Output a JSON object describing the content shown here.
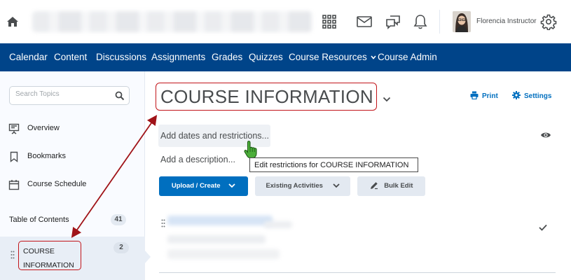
{
  "topbar": {
    "user_name": "Florencia Instructor"
  },
  "nav": {
    "items": [
      "Calendar",
      "Content",
      "Discussions",
      "Assignments",
      "Grades",
      "Quizzes",
      "Course Resources",
      "Course Admin"
    ]
  },
  "sidebar": {
    "search_placeholder": "Search Topics",
    "links": [
      "Overview",
      "Bookmarks",
      "Course Schedule"
    ],
    "toc_label": "Table of Contents",
    "toc_count": "41",
    "module_label": "COURSE INFORMATION",
    "module_count": "2"
  },
  "main": {
    "title": "COURSE INFORMATION",
    "print_label": "Print",
    "settings_label": "Settings",
    "add_dates_label": "Add dates and restrictions...",
    "add_description_label": "Add a description...",
    "tooltip": "Edit restrictions for COURSE INFORMATION",
    "upload_create_label": "Upload / Create",
    "existing_activities_label": "Existing Activities",
    "bulk_edit_label": "Bulk Edit"
  },
  "colors": {
    "nav_background": "#004489",
    "primary_button": "#006fbf",
    "annotation_red": "#c2151a",
    "cursor_green": "#4cae3a"
  },
  "icons": [
    "home-icon",
    "waffle-icon",
    "mail-icon",
    "chat-icon",
    "bell-icon",
    "gear-icon",
    "search-icon",
    "presentation-icon",
    "bookmark-icon",
    "calendar-icon",
    "printer-icon",
    "eye-icon",
    "checkmark-icon",
    "hand-cursor-icon"
  ]
}
